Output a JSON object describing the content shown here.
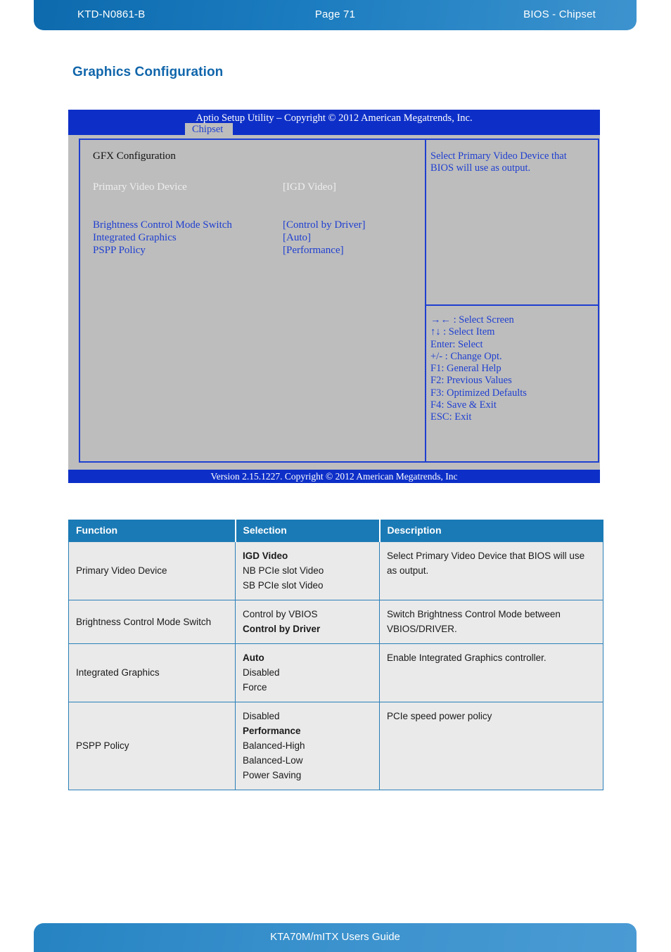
{
  "header": {
    "left": "KTD-N0861-B",
    "center": "Page 71",
    "right": "BIOS  - Chipset"
  },
  "footer": {
    "text": "KTA70M/mITX Users Guide"
  },
  "section": {
    "title": "Graphics Configuration"
  },
  "bios": {
    "title": "Aptio Setup Utility  –  Copyright © 2012 American Megatrends, Inc.",
    "tab": "Chipset",
    "group_heading": "GFX Configuration",
    "options": [
      {
        "label": "Primary Video Device",
        "value": "[IGD Video]"
      },
      {
        "label": "Brightness Control Mode Switch",
        "value": "[Control by Driver]"
      },
      {
        "label": "Integrated Graphics",
        "value": "[Auto]"
      },
      {
        "label": "PSPP Policy",
        "value": "[Performance]"
      }
    ],
    "help_text": "Select Primary Video Device that BIOS will use as output.",
    "keys": [
      "→← : Select Screen",
      "↑↓ : Select Item",
      "Enter: Select",
      "+/- : Change Opt.",
      "F1: General Help",
      "F2: Previous Values",
      "F3: Optimized Defaults",
      "F4: Save & Exit",
      "ESC: Exit"
    ],
    "version": "Version 2.15.1227. Copyright © 2012 American Megatrends, Inc"
  },
  "table": {
    "columns": [
      "Function",
      "Selection",
      "Description"
    ],
    "rows": [
      {
        "function": "Primary Video Device",
        "selections": [
          {
            "text": "IGD Video",
            "bold": true
          },
          {
            "text": "NB PCIe slot Video",
            "bold": false
          },
          {
            "text": "SB PCIe slot Video",
            "bold": false
          }
        ],
        "description": "Select Primary Video Device that BIOS will use as output."
      },
      {
        "function": "Brightness Control Mode Switch",
        "selections": [
          {
            "text": "Control by VBIOS",
            "bold": false
          },
          {
            "text": "Control by Driver",
            "bold": true
          }
        ],
        "description": "Switch Brightness Control Mode between VBIOS/DRIVER."
      },
      {
        "function": "Integrated Graphics",
        "selections": [
          {
            "text": "Auto",
            "bold": true
          },
          {
            "text": "Disabled",
            "bold": false
          },
          {
            "text": "Force",
            "bold": false
          }
        ],
        "description": "Enable Integrated Graphics controller."
      },
      {
        "function": "PSPP Policy",
        "selections": [
          {
            "text": "Disabled",
            "bold": false
          },
          {
            "text": "Performance",
            "bold": true
          },
          {
            "text": "Balanced-High",
            "bold": false
          },
          {
            "text": "Balanced-Low",
            "bold": false
          },
          {
            "text": "Power Saving",
            "bold": false
          }
        ],
        "description": "PCIe speed power policy"
      }
    ]
  },
  "colors": {
    "header_blue": "#1b7cbf",
    "title_blue": "#1166ab",
    "bios_blue": "#0d2fc8",
    "bios_gray": "#bdbdbd",
    "table_header": "#1a7ab5",
    "table_row": "#eaeaea"
  }
}
